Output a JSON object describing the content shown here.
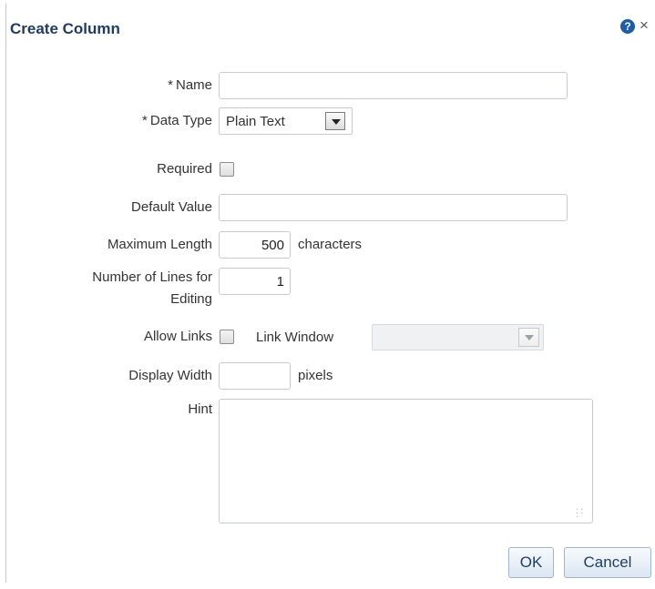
{
  "dialog": {
    "title": "Create Column",
    "help_icon": "help-icon",
    "close_icon": "close-icon",
    "close_glyph": "×",
    "help_glyph": "?"
  },
  "form": {
    "required_marker": "*",
    "name": {
      "label": "Name",
      "value": ""
    },
    "data_type": {
      "label": "Data Type",
      "selected": "Plain Text"
    },
    "required": {
      "label": "Required",
      "checked": false
    },
    "default_value": {
      "label": "Default Value",
      "value": ""
    },
    "max_length": {
      "label": "Maximum Length",
      "value": "500",
      "suffix": "characters"
    },
    "lines_for_editing": {
      "label_line1": "Number of Lines for",
      "label_line2": "Editing",
      "value": "1"
    },
    "allow_links": {
      "label": "Allow Links",
      "checked": false
    },
    "link_window": {
      "label": "Link Window",
      "selected": ""
    },
    "display_width": {
      "label": "Display Width",
      "value": "",
      "suffix": "pixels"
    },
    "hint": {
      "label": "Hint",
      "value": ""
    }
  },
  "buttons": {
    "ok": "OK",
    "cancel": "Cancel"
  },
  "colors": {
    "title": "#1f3c5f",
    "help_icon": "#1d5ea5",
    "button_border": "#9fb4cd"
  }
}
